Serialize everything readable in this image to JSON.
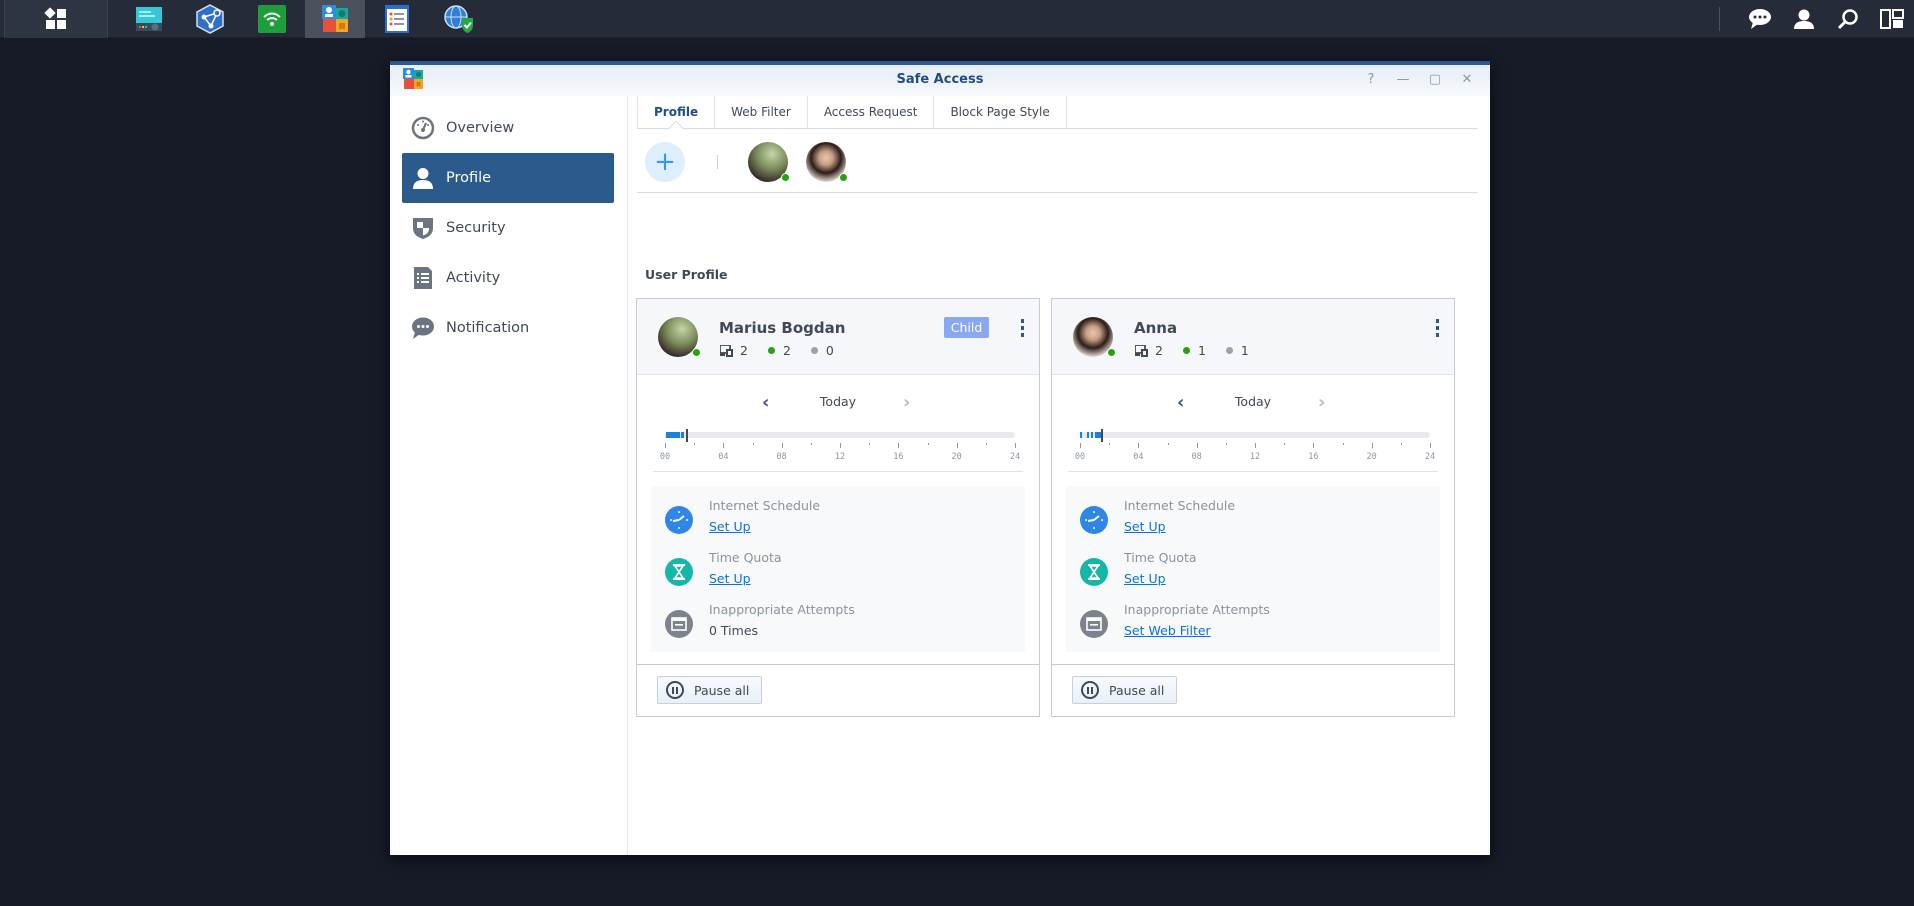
{
  "taskbar": {
    "apps": [
      {
        "name": "main-menu",
        "icon": "grid-icon",
        "active": false
      },
      {
        "name": "storage-manager",
        "icon": "storage-manager-icon",
        "active": false
      },
      {
        "name": "mesh-network",
        "icon": "network-hexagon-icon",
        "active": false
      },
      {
        "name": "wifi-connect",
        "icon": "wifi-icon",
        "active": false
      },
      {
        "name": "safe-access",
        "icon": "safe-access-icon",
        "active": true
      },
      {
        "name": "log-center",
        "icon": "log-icon",
        "active": false
      },
      {
        "name": "security-globe",
        "icon": "globe-shield-icon",
        "active": false
      }
    ],
    "right_icons": [
      "chat-icon",
      "user-icon",
      "search-icon",
      "widgets-icon"
    ]
  },
  "window": {
    "title": "Safe Access",
    "controls": {
      "help": "?",
      "minimize": "—",
      "maximize": "▢",
      "close": "✕"
    }
  },
  "sidebar": {
    "items": [
      {
        "label": "Overview",
        "icon": "gauge-icon",
        "active": false
      },
      {
        "label": "Profile",
        "icon": "user-icon",
        "active": true
      },
      {
        "label": "Security",
        "icon": "shield-icon",
        "active": false
      },
      {
        "label": "Activity",
        "icon": "document-list-icon",
        "active": false
      },
      {
        "label": "Notification",
        "icon": "speech-bubble-icon",
        "active": false
      }
    ]
  },
  "tabs": [
    {
      "label": "Profile",
      "active": true
    },
    {
      "label": "Web Filter",
      "active": false
    },
    {
      "label": "Access Request",
      "active": false
    },
    {
      "label": "Block Page Style",
      "active": false
    }
  ],
  "avatar_row": {
    "add_label": "+",
    "users": [
      {
        "name": "Marius Bogdan",
        "online": true
      },
      {
        "name": "Anna",
        "online": true
      }
    ]
  },
  "section_title": "User Profile",
  "colors": {
    "accent": "#2b5a8c",
    "badge": "#8aa7f2",
    "online": "#28a012",
    "offline": "#9aa1a9",
    "link": "#0a73d9",
    "timeline_usage": "#1a7fe0"
  },
  "profiles": [
    {
      "name": "Marius Bogdan",
      "badge": "Child",
      "devices": "2",
      "online_devices": "2",
      "offline_devices": "0",
      "day_label": "Today",
      "timeline": {
        "hour_labels": [
          "00",
          "04",
          "08",
          "12",
          "16",
          "20",
          "24"
        ],
        "usage_hours": [
          [
            0.05,
            1.0
          ],
          [
            1.1,
            1.3
          ]
        ],
        "now_hour": 1.45
      },
      "features": [
        {
          "title": "Internet Schedule",
          "value": "Set Up",
          "is_link": true,
          "icon": "clock-icon"
        },
        {
          "title": "Time Quota",
          "value": "Set Up",
          "is_link": true,
          "icon": "hourglass-icon"
        },
        {
          "title": "Inappropriate Attempts",
          "value": "0 Times",
          "is_link": false,
          "icon": "browser-window-icon"
        }
      ],
      "pause_label": "Pause all"
    },
    {
      "name": "Anna",
      "badge": "",
      "devices": "2",
      "online_devices": "1",
      "offline_devices": "1",
      "day_label": "Today",
      "timeline": {
        "hour_labels": [
          "00",
          "04",
          "08",
          "12",
          "16",
          "20",
          "24"
        ],
        "usage_hours": [
          [
            0.0,
            0.15
          ],
          [
            0.45,
            0.6
          ],
          [
            0.75,
            0.9
          ],
          [
            1.05,
            1.45
          ]
        ],
        "now_hour": 1.45
      },
      "features": [
        {
          "title": "Internet Schedule",
          "value": "Set Up",
          "is_link": true,
          "icon": "clock-icon"
        },
        {
          "title": "Time Quota",
          "value": "Set Up",
          "is_link": true,
          "icon": "hourglass-icon"
        },
        {
          "title": "Inappropriate Attempts",
          "value": "Set Web Filter",
          "is_link": true,
          "icon": "browser-window-icon"
        }
      ],
      "pause_label": "Pause all"
    }
  ]
}
